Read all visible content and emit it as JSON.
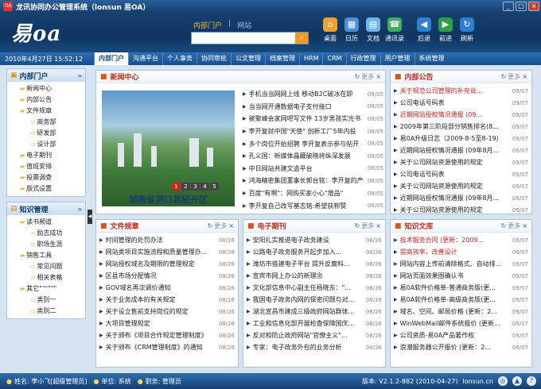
{
  "titlebar": {
    "title": "龙讯协同办公管理系统（lonsun 易OA）",
    "minimize": "_",
    "maximize": "□",
    "close": "×"
  },
  "header": {
    "logo": "易oa",
    "tabs": [
      "内部门户",
      "网站"
    ],
    "search_placeholder": "",
    "toolbar": [
      {
        "label": "桌面",
        "icon": "home-icon",
        "color": "#f0a030"
      },
      {
        "label": "日历",
        "icon": "calendar-icon",
        "color": "#4a90d9"
      },
      {
        "label": "文档",
        "icon": "document-icon",
        "color": "#6fb3e8"
      },
      {
        "label": "通讯录",
        "icon": "contacts-icon",
        "color": "#3cb05a"
      },
      {
        "label": "后退",
        "icon": "back-icon",
        "color": "#2f7fd0"
      },
      {
        "label": "前进",
        "icon": "forward-icon",
        "color": "#2f9f46"
      },
      {
        "label": "刷新",
        "icon": "refresh-icon",
        "color": "#2f7fd0"
      }
    ]
  },
  "navbar": {
    "datetime": "2010年4月27日 15:52:12",
    "items": [
      "内部门户",
      "沟通平台",
      "个人事务",
      "协同审批",
      "公文管理",
      "档案管理",
      "HRM",
      "CRM",
      "行政管理",
      "用户管理",
      "系统管理"
    ]
  },
  "sidebar": {
    "portal": {
      "title": "内部门户",
      "items": [
        {
          "label": "新闻中心",
          "level": 1
        },
        {
          "label": "内部公告",
          "level": 1
        },
        {
          "label": "文件规章",
          "level": 1
        },
        {
          "label": "商务部",
          "level": 2
        },
        {
          "label": "研发部",
          "level": 2
        },
        {
          "label": "设计部",
          "level": 2
        },
        {
          "label": "电子期刊",
          "level": 1
        },
        {
          "label": "值班安排",
          "level": 1
        },
        {
          "label": "投票调查",
          "level": 1
        },
        {
          "label": "版式设置",
          "level": 1
        }
      ]
    },
    "knowledge": {
      "title": "知识管理",
      "items": [
        {
          "label": "读书频道",
          "level": 1
        },
        {
          "label": "励志成功",
          "level": 2
        },
        {
          "label": "职场生涯",
          "level": 2
        },
        {
          "label": "销售工具",
          "level": 1
        },
        {
          "label": "常见问题",
          "level": 2
        },
        {
          "label": "相关表格",
          "level": 2
        },
        {
          "label": "其它\"\"\"\"\"\"",
          "level": 1
        },
        {
          "label": "类别一",
          "level": 2
        },
        {
          "label": "类别二",
          "level": 2
        }
      ]
    }
  },
  "more_label": "更多",
  "news": {
    "title": "新闻中心",
    "caption": "湖南省洞口县经开区",
    "pager": [
      "1",
      "2",
      "3",
      "4",
      "5"
    ],
    "items": [
      {
        "t": "手机当当网网上线 移动B2C破冰在即",
        "d": "08/05"
      },
      {
        "t": "当当网开通数据电子支付接口",
        "d": "08/05"
      },
      {
        "t": "被聚峰会家网吧写文件 13岁男孩实光书",
        "d": "08/05"
      },
      {
        "t": "李开复就中国\"天使\" 创新工厂5年内投",
        "d": "08/05"
      },
      {
        "t": "多个岗位开始招聘 李开复表示参与帖开",
        "d": "08/05"
      },
      {
        "t": "孔义国：新媒体晶藏破晓将纵深发展",
        "d": "08/05"
      },
      {
        "t": "中日网站共建文选平台",
        "d": "08/05"
      },
      {
        "t": "鸿海精密集团董事长郭台铭：李开复的产",
        "d": "08/05"
      },
      {
        "t": "百度\"有啊\"：网购买家小心\"增品\"",
        "d": "08/05"
      },
      {
        "t": "李开复自己改写基志铭:希望获称赞",
        "d": "08/05"
      }
    ]
  },
  "notices": {
    "title": "内部公告",
    "items": [
      {
        "t": "关于规范公司管理的补充说...",
        "d": "09/07",
        "red": true
      },
      {
        "t": "公司电话号码表",
        "d": "09/07"
      },
      {
        "t": "近期网站授权情况通报 (09...",
        "d": "09/07",
        "red": true
      },
      {
        "t": "2009年第三阶段部分销售排名(8...",
        "d": "09/07"
      },
      {
        "t": "易0A升级日志（2009-8-5至8-19）",
        "d": "09/07"
      },
      {
        "t": "近期网站授权情况通报 (09年8月...",
        "d": "09/07"
      },
      {
        "t": "关于公司网站资源使用的规定",
        "d": "09/07"
      },
      {
        "t": "公司电话号码表",
        "d": "09/07"
      },
      {
        "t": "关于公司网站资源使用的规定",
        "d": "09/07"
      },
      {
        "t": "近期网站授权情况通报 (09年8月...",
        "d": "09/07"
      },
      {
        "t": "关于公司网站资源使用的规定",
        "d": "09/07"
      }
    ]
  },
  "rules": {
    "title": "文件规章",
    "items": [
      {
        "t": "时间管理的处罚办法",
        "d": "08/26"
      },
      {
        "t": "网站类项目实施流程和质量管理办...",
        "d": "08/26"
      },
      {
        "t": "网站授权域名及期限的管理规定",
        "d": "08/26"
      },
      {
        "t": "区县市场分配情况",
        "d": "08/26"
      },
      {
        "t": "GOV域名再次调价通知",
        "d": "08/26"
      },
      {
        "t": "关于业务成本的有关规定",
        "d": "08/26"
      },
      {
        "t": "关于设立售前支持岗位的规定",
        "d": "08/26"
      },
      {
        "t": "大项目管理规定",
        "d": "08/26"
      },
      {
        "t": "关于颁布《项目合作规定管理制度》",
        "d": "08/26"
      },
      {
        "t": "关于颁布《CRM管理制度》的通知",
        "d": "08/26"
      }
    ]
  },
  "journal": {
    "title": "电子期刊",
    "items": [
      {
        "t": "安阳扎实推进电子政务建设",
        "d": "08/26"
      },
      {
        "t": "公路电子政务服务开起步加入...",
        "d": "08/26"
      },
      {
        "t": "潍坊市搭建电子平台 提升反腐科...",
        "d": "08/26"
      },
      {
        "t": "宣宾市网上办公的新理念",
        "d": "08/26"
      },
      {
        "t": "文化部信息中心副主任杨晓东：\"...",
        "d": "08/26"
      },
      {
        "t": "我国电子政务内网的保密问题与对...",
        "d": "08/26"
      },
      {
        "t": "湖北宣昌市建成三级政府网站群体...",
        "d": "08/26"
      },
      {
        "t": "工业和信息化部开展检查保障国庆...",
        "d": "08/26"
      },
      {
        "t": "反对和防止政府网站\"官僚主义\"...",
        "d": "08/26"
      },
      {
        "t": "专家：电子政务外包的业务分析",
        "d": "08/26"
      }
    ]
  },
  "library": {
    "title": "知识文库",
    "items": [
      {
        "t": "技术服务合同 (更新：2009...",
        "d": "09/07",
        "red": true
      },
      {
        "t": "提高效率，改善设计",
        "d": "09/07",
        "red": true
      },
      {
        "t": "网站内容上传前清除格式、自动排...",
        "d": "09/07"
      },
      {
        "t": "网站页面效果图确认书",
        "d": "09/07"
      },
      {
        "t": "易0A软件价格单-普通商务版(更...",
        "d": "09/07"
      },
      {
        "t": "易0A软件价格单-高级商务版(更...",
        "d": "09/07"
      },
      {
        "t": "域名、空间、邮局价格 (更新：2...",
        "d": "09/07"
      },
      {
        "t": "WinWebMail邮件系统报价 (更新...",
        "d": "09/07"
      },
      {
        "t": "公司资质-易0A产品著作权",
        "d": "09/07"
      },
      {
        "t": "浪潮服务器公开报价 (更新：2...",
        "d": "09/07"
      }
    ]
  },
  "status": {
    "user": "姓名: 李小飞[超级管理员]",
    "unit": "单位: 系统",
    "role": "职务: 管理员",
    "version": "版本: V2.1.2-882 (2010-04-27)",
    "site": "lonsun.cn"
  }
}
